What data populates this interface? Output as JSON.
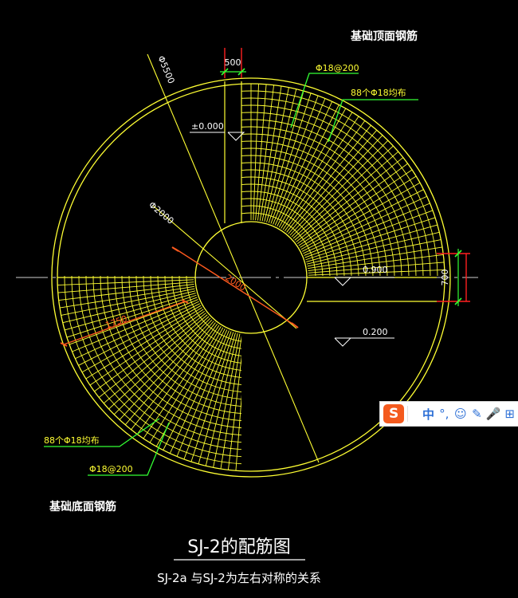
{
  "drawing": {
    "top_title": "基础顶面钢筋",
    "bottom_title": "基础底面钢筋",
    "main_title": "SJ-2的配筋图",
    "subtitle": "SJ-2a 与SJ-2为左右对称的关系",
    "dims": {
      "outer_diameter": "Φ5500",
      "inner_diameter": "Φ2000",
      "center_dim": "2000",
      "radial_dim": "1750",
      "gap_width": "500",
      "right_height": "700"
    },
    "levels": {
      "top": "±0.000",
      "middle": "0.900",
      "bottom": "0.200"
    },
    "rebar_labels": {
      "top_spacing": "Φ18@200",
      "top_count": "88个Φ18均布",
      "bottom_count": "88个Φ18均布",
      "bottom_spacing": "Φ18@200"
    },
    "colors": {
      "background": "#000000",
      "drawing": "#ffff33",
      "dimension": "#ff5a1e",
      "leader": "#33ff33",
      "annotation": "#ffffff",
      "axis": "#cfcfcf",
      "dim_marks": "#ff2020"
    }
  },
  "ime_toolbar": {
    "logo": "S",
    "language": "中",
    "punct": "°,",
    "items": [
      {
        "name": "emoji-icon",
        "glyph": "☺"
      },
      {
        "name": "pen-icon",
        "glyph": "✎"
      },
      {
        "name": "mic-icon",
        "glyph": "🎤"
      },
      {
        "name": "grid-icon",
        "glyph": "⊞"
      }
    ]
  }
}
